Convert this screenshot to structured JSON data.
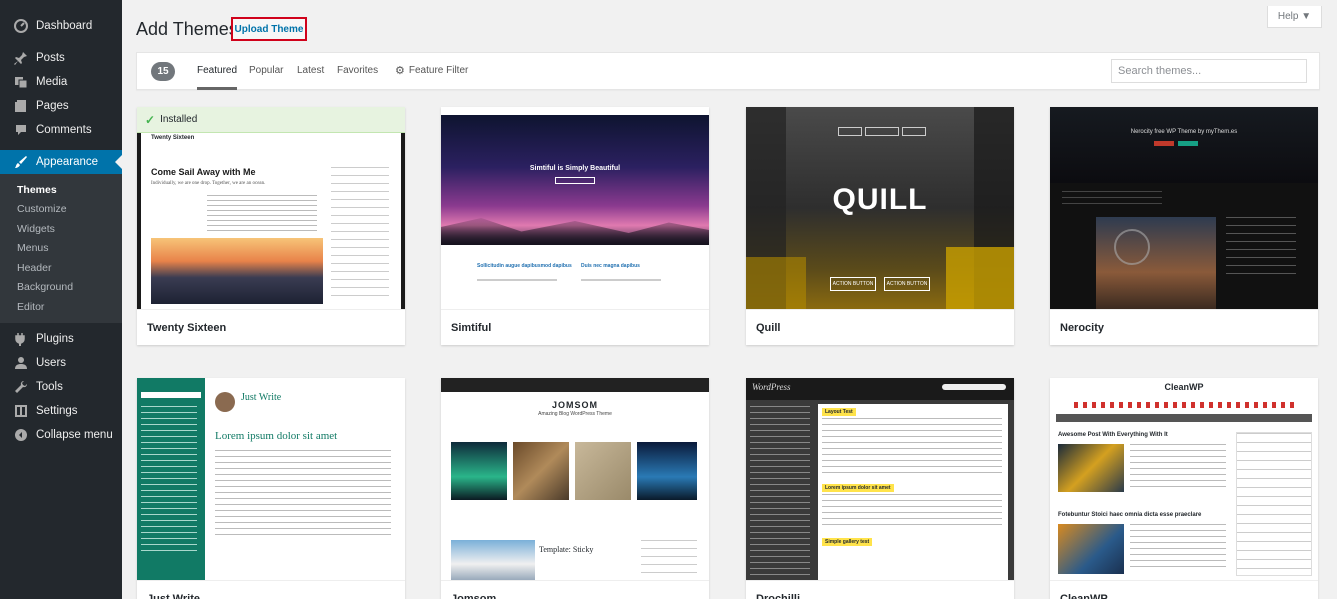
{
  "sidebar": {
    "items": [
      {
        "label": "Dashboard",
        "icon": "dashboard-icon"
      },
      {
        "label": "Posts",
        "icon": "pin-icon"
      },
      {
        "label": "Media",
        "icon": "media-icon"
      },
      {
        "label": "Pages",
        "icon": "page-icon"
      },
      {
        "label": "Comments",
        "icon": "comment-icon"
      },
      {
        "label": "Appearance",
        "icon": "brush-icon"
      }
    ],
    "submenu": [
      "Themes",
      "Customize",
      "Widgets",
      "Menus",
      "Header",
      "Background",
      "Editor"
    ],
    "lower_items": [
      {
        "label": "Plugins",
        "icon": "plug-icon"
      },
      {
        "label": "Users",
        "icon": "user-icon"
      },
      {
        "label": "Tools",
        "icon": "wrench-icon"
      },
      {
        "label": "Settings",
        "icon": "settings-icon"
      },
      {
        "label": "Collapse menu",
        "icon": "collapse-icon"
      }
    ]
  },
  "header": {
    "title": "Add Themes",
    "upload_label": "Upload Theme",
    "help_label": "Help ▼"
  },
  "filter": {
    "count": "15",
    "tabs": [
      "Featured",
      "Popular",
      "Latest",
      "Favorites"
    ],
    "feature_filter": "Feature Filter",
    "search_placeholder": "Search themes..."
  },
  "themes": [
    {
      "name": "Twenty Sixteen",
      "installed": "Installed",
      "preview": {
        "site": "Twenty Sixteen",
        "headline": "Come Sail Away with Me",
        "tagline": "Individually, we are one drop. Together, we are an ocean."
      }
    },
    {
      "name": "Simtiful",
      "preview": {
        "headline": "Simtiful is Simply Beautiful",
        "post1": "Sollicitudin augue dapibusmod dapibus",
        "post2": "Duis nec magna dapibus"
      }
    },
    {
      "name": "Quill",
      "preview": {
        "logo": "QUILL",
        "button1": "ACTION BUTTON",
        "button2": "ACTION BUTTON"
      }
    },
    {
      "name": "Nerocity",
      "preview": {
        "headline": "Nerocity free WP Theme by myThem.es"
      }
    },
    {
      "name": "Just Write",
      "preview": {
        "site": "Just Write",
        "headline": "Lorem ipsum dolor sit amet"
      }
    },
    {
      "name": "Jomsom",
      "preview": {
        "site": "JOMSOM",
        "tagline": "Amazing Blog WordPress Theme",
        "sticky": "Template: Sticky"
      }
    },
    {
      "name": "Drochilli",
      "preview": {
        "site": "WordPress",
        "box1": "Layout Test",
        "box2": "Lorem ipsum dolor sit amet",
        "box3": "Simple gallery test"
      }
    },
    {
      "name": "CleanWP",
      "preview": {
        "site": "CleanWP",
        "post1": "Awesome Post With Everything With It",
        "post2": "Fotebuntur Stoici haec omnia dicta esse praeclare"
      }
    }
  ],
  "colors": {
    "accent": "#0073aa",
    "sidebar": "#23282d",
    "highlight_border": "#d0021b"
  }
}
